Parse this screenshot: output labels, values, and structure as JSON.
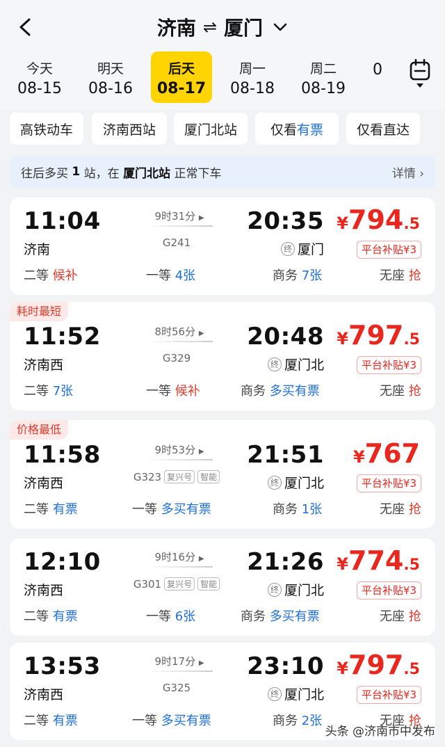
{
  "header": {
    "from": "济南",
    "swap": "⇌",
    "to": "厦门"
  },
  "dates": [
    {
      "week": "今天",
      "date": "08-15"
    },
    {
      "week": "明天",
      "date": "08-16"
    },
    {
      "week": "后天",
      "date": "08-17",
      "selected": true
    },
    {
      "week": "周一",
      "date": "08-18"
    },
    {
      "week": "周二",
      "date": "08-19"
    },
    {
      "week": "",
      "date": "0"
    }
  ],
  "filters": [
    {
      "label": "高铁动车"
    },
    {
      "label": "济南西站"
    },
    {
      "label": "厦门北站"
    },
    {
      "label_pre": "仅看",
      "label_hl": "有票"
    },
    {
      "label": "仅看直达"
    }
  ],
  "notice": {
    "prefix": "往后多买",
    "count": "1",
    "mid": "站，在",
    "station": "厦门北站",
    "suffix": "正常下车",
    "detail": "详情"
  },
  "trains": [
    {
      "tag": "",
      "dep_time": "11:04",
      "dep_station": "济南",
      "duration": "9时31分",
      "train_no": "G241",
      "badges": [],
      "arr_time": "20:35",
      "arr_station": "厦门",
      "price_main": "794",
      "price_frac": ".5",
      "subsidy": "平台补贴¥3",
      "seats": [
        {
          "cls": "二等",
          "status": "候补",
          "color": "red"
        },
        {
          "cls": "一等",
          "status": "4张",
          "color": "blue"
        },
        {
          "cls": "商务",
          "status": "7张",
          "color": "blue"
        },
        {
          "cls": "无座",
          "status": "抢",
          "color": "red"
        }
      ]
    },
    {
      "tag": "耗时最短",
      "dep_time": "11:52",
      "dep_station": "济南西",
      "duration": "8时56分",
      "train_no": "G329",
      "badges": [],
      "arr_time": "20:48",
      "arr_station": "厦门北",
      "price_main": "797",
      "price_frac": ".5",
      "subsidy": "平台补贴¥3",
      "seats": [
        {
          "cls": "二等",
          "status": "7张",
          "color": "blue"
        },
        {
          "cls": "一等",
          "status": "候补",
          "color": "red"
        },
        {
          "cls": "商务",
          "status": "多买有票",
          "color": "blue"
        },
        {
          "cls": "无座",
          "status": "抢",
          "color": "red"
        }
      ]
    },
    {
      "tag": "价格最低",
      "dep_time": "11:58",
      "dep_station": "济南西",
      "duration": "9时53分",
      "train_no": "G323",
      "badges": [
        "复兴号",
        "智能"
      ],
      "arr_time": "21:51",
      "arr_station": "厦门北",
      "price_main": "767",
      "price_frac": "",
      "subsidy": "平台补贴¥3",
      "seats": [
        {
          "cls": "二等",
          "status": "有票",
          "color": "blue"
        },
        {
          "cls": "一等",
          "status": "多买有票",
          "color": "blue"
        },
        {
          "cls": "商务",
          "status": "1张",
          "color": "blue"
        },
        {
          "cls": "无座",
          "status": "抢",
          "color": "red"
        }
      ]
    },
    {
      "tag": "",
      "dep_time": "12:10",
      "dep_station": "济南西",
      "duration": "9时16分",
      "train_no": "G301",
      "badges": [
        "复兴号",
        "智能"
      ],
      "arr_time": "21:26",
      "arr_station": "厦门北",
      "price_main": "774",
      "price_frac": ".5",
      "subsidy": "平台补贴¥3",
      "seats": [
        {
          "cls": "二等",
          "status": "有票",
          "color": "blue"
        },
        {
          "cls": "一等",
          "status": "6张",
          "color": "blue"
        },
        {
          "cls": "商务",
          "status": "多买有票",
          "color": "blue"
        },
        {
          "cls": "无座",
          "status": "抢",
          "color": "red"
        }
      ]
    },
    {
      "tag": "",
      "dep_time": "13:53",
      "dep_station": "济南西",
      "duration": "9时17分",
      "train_no": "G325",
      "badges": [],
      "arr_time": "23:10",
      "arr_station": "厦门北",
      "price_main": "797",
      "price_frac": ".5",
      "subsidy": "平台补贴¥3",
      "seats": [
        {
          "cls": "二等",
          "status": "有票",
          "color": "blue"
        },
        {
          "cls": "一等",
          "status": "多买有票",
          "color": "blue"
        },
        {
          "cls": "商务",
          "status": "2张",
          "color": "blue"
        },
        {
          "cls": "无座",
          "status": "抢",
          "color": "red"
        }
      ]
    }
  ],
  "terminal_mark": "终",
  "yen": "¥",
  "watermark": "头条 @济南市中发布"
}
